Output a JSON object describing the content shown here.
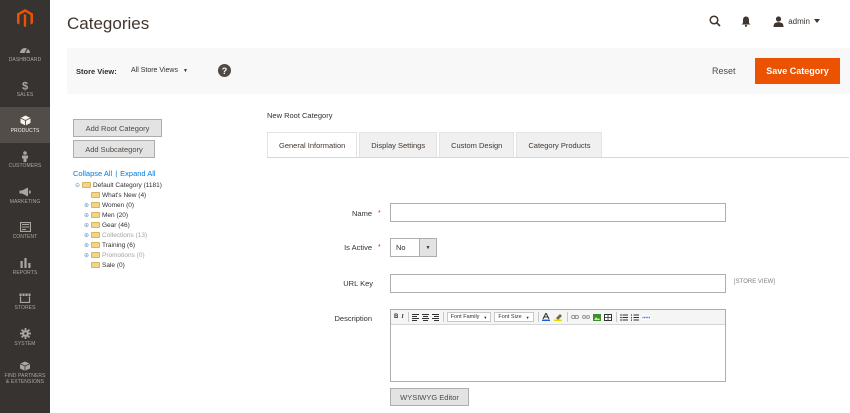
{
  "sidebar": {
    "logo": "magento-logo",
    "items": [
      {
        "label": "DASHBOARD",
        "icon": "dashboard-icon"
      },
      {
        "label": "SALES",
        "icon": "dollar-icon"
      },
      {
        "label": "PRODUCTS",
        "icon": "cube-icon",
        "active": true
      },
      {
        "label": "CUSTOMERS",
        "icon": "person-icon"
      },
      {
        "label": "MARKETING",
        "icon": "megaphone-icon"
      },
      {
        "label": "CONTENT",
        "icon": "layout-icon"
      },
      {
        "label": "REPORTS",
        "icon": "bar-chart-icon"
      },
      {
        "label": "STORES",
        "icon": "store-icon"
      },
      {
        "label": "SYSTEM",
        "icon": "gear-icon"
      },
      {
        "label": "FIND PARTNERS\n& EXTENSIONS",
        "icon": "boxes-icon"
      }
    ]
  },
  "header": {
    "title": "Categories",
    "user": "admin"
  },
  "storebar": {
    "label": "Store View:",
    "selected": "All Store Views",
    "help": "?",
    "reset_label": "Reset",
    "save_label": "Save Category"
  },
  "left": {
    "add_root": "Add Root Category",
    "add_sub": "Add Subcategory",
    "collapse_all": "Collapse All",
    "separator": "|",
    "expand_all": "Expand All",
    "tree": [
      {
        "label": "Default Category (1181)",
        "level": 0,
        "exp": "⊖",
        "dim": false
      },
      {
        "label": "What's New (4)",
        "level": 1,
        "exp": "",
        "dim": false
      },
      {
        "label": "Women (0)",
        "level": 1,
        "exp": "⊕",
        "dim": false
      },
      {
        "label": "Men (20)",
        "level": 1,
        "exp": "⊕",
        "dim": false
      },
      {
        "label": "Gear (46)",
        "level": 1,
        "exp": "⊕",
        "dim": false
      },
      {
        "label": "Collections (13)",
        "level": 1,
        "exp": "⊕",
        "dim": true
      },
      {
        "label": "Training (6)",
        "level": 1,
        "exp": "⊕",
        "dim": false
      },
      {
        "label": "Promotions (0)",
        "level": 1,
        "exp": "⊕",
        "dim": true
      },
      {
        "label": "Sale (0)",
        "level": 1,
        "exp": "",
        "dim": false
      }
    ]
  },
  "content": {
    "section_title": "New Root Category",
    "tabs": [
      {
        "label": "General Information",
        "active": true
      },
      {
        "label": "Display Settings",
        "active": false
      },
      {
        "label": "Custom Design",
        "active": false
      },
      {
        "label": "Category Products",
        "active": false
      }
    ],
    "fields": {
      "name_label": "Name",
      "name_value": "",
      "is_active_label": "Is Active",
      "is_active_value": "No",
      "url_key_label": "URL Key",
      "url_key_value": "",
      "url_key_scope": "[STORE VIEW]",
      "description_label": "Description",
      "required_mark": "*"
    },
    "editor": {
      "bold": "B",
      "italic": "I",
      "font_family": "Font Family",
      "font_size": "Font Size",
      "wysiwyg_button": "WYSIWYG Editor"
    }
  },
  "colors": {
    "sidebar_bg": "#373330",
    "sidebar_active": "#524d49",
    "accent": "#eb5202",
    "link": "#007bdb"
  }
}
